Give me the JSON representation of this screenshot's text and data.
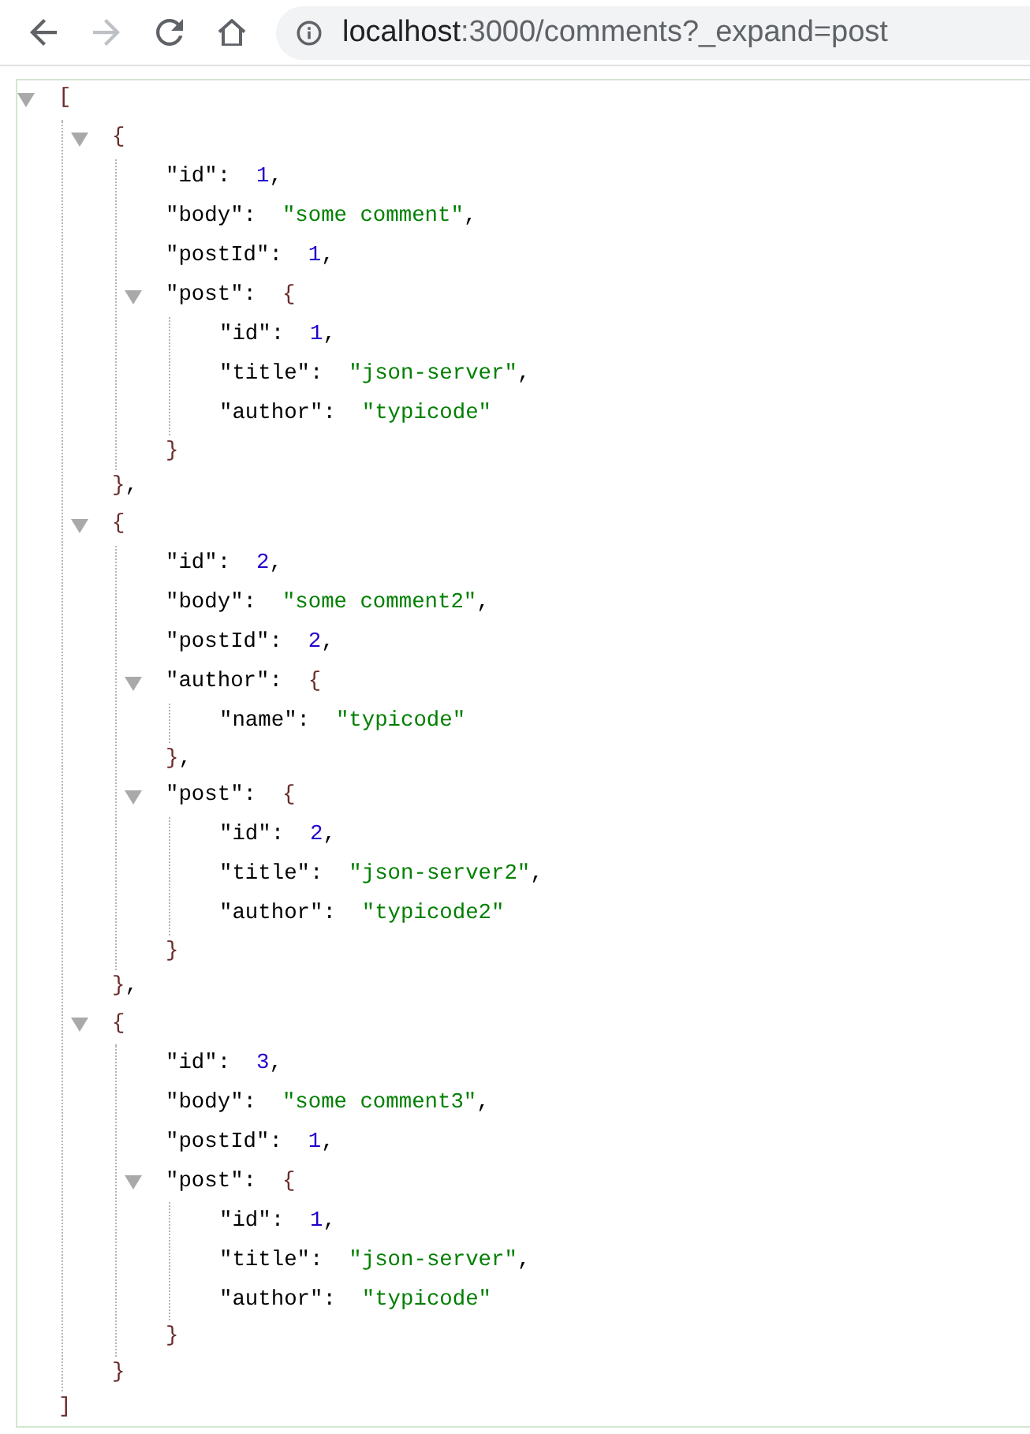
{
  "toolbar": {
    "nav_buttons": [
      {
        "kind": "back",
        "disabled": false
      },
      {
        "kind": "forward",
        "disabled": true
      },
      {
        "kind": "reload",
        "disabled": false
      },
      {
        "kind": "home",
        "disabled": false
      }
    ],
    "address_bar": {
      "host": "localhost",
      "rest": ":3000/comments?_expand=post"
    }
  },
  "json_viewer": {
    "root": {
      "kind": "array",
      "open": "[",
      "close": "]",
      "expanded": true,
      "children": [
        {
          "kind": "object",
          "open": "{",
          "close": "}",
          "trailing": ",",
          "expanded": true,
          "children": [
            {
              "kind": "number",
              "key": "\"id\":",
              "value": "1",
              "trailing": ","
            },
            {
              "kind": "string",
              "key": "\"body\":",
              "value": "\"some comment\"",
              "trailing": ","
            },
            {
              "kind": "number",
              "key": "\"postId\":",
              "value": "1",
              "trailing": ","
            },
            {
              "kind": "object",
              "key": "\"post\":",
              "open": "{",
              "close": "}",
              "expanded": true,
              "children": [
                {
                  "kind": "number",
                  "key": "\"id\":",
                  "value": "1",
                  "trailing": ","
                },
                {
                  "kind": "string",
                  "key": "\"title\":",
                  "value": "\"json-server\"",
                  "trailing": ","
                },
                {
                  "kind": "string",
                  "key": "\"author\":",
                  "value": "\"typicode\""
                }
              ]
            }
          ]
        },
        {
          "kind": "object",
          "open": "{",
          "close": "}",
          "trailing": ",",
          "expanded": true,
          "children": [
            {
              "kind": "number",
              "key": "\"id\":",
              "value": "2",
              "trailing": ","
            },
            {
              "kind": "string",
              "key": "\"body\":",
              "value": "\"some comment2\"",
              "trailing": ","
            },
            {
              "kind": "number",
              "key": "\"postId\":",
              "value": "2",
              "trailing": ","
            },
            {
              "kind": "object",
              "key": "\"author\":",
              "open": "{",
              "close": "}",
              "trailing": ",",
              "expanded": true,
              "children": [
                {
                  "kind": "string",
                  "key": "\"name\":",
                  "value": "\"typicode\""
                }
              ]
            },
            {
              "kind": "object",
              "key": "\"post\":",
              "open": "{",
              "close": "}",
              "expanded": true,
              "children": [
                {
                  "kind": "number",
                  "key": "\"id\":",
                  "value": "2",
                  "trailing": ","
                },
                {
                  "kind": "string",
                  "key": "\"title\":",
                  "value": "\"json-server2\"",
                  "trailing": ","
                },
                {
                  "kind": "string",
                  "key": "\"author\":",
                  "value": "\"typicode2\""
                }
              ]
            }
          ]
        },
        {
          "kind": "object",
          "open": "{",
          "close": "}",
          "expanded": true,
          "children": [
            {
              "kind": "number",
              "key": "\"id\":",
              "value": "3",
              "trailing": ","
            },
            {
              "kind": "string",
              "key": "\"body\":",
              "value": "\"some comment3\"",
              "trailing": ","
            },
            {
              "kind": "number",
              "key": "\"postId\":",
              "value": "1",
              "trailing": ","
            },
            {
              "kind": "object",
              "key": "\"post\":",
              "open": "{",
              "close": "}",
              "expanded": true,
              "children": [
                {
                  "kind": "number",
                  "key": "\"id\":",
                  "value": "1",
                  "trailing": ","
                },
                {
                  "kind": "string",
                  "key": "\"title\":",
                  "value": "\"json-server\"",
                  "trailing": ","
                },
                {
                  "kind": "string",
                  "key": "\"author\":",
                  "value": "\"typicode\""
                }
              ]
            }
          ]
        }
      ]
    }
  }
}
